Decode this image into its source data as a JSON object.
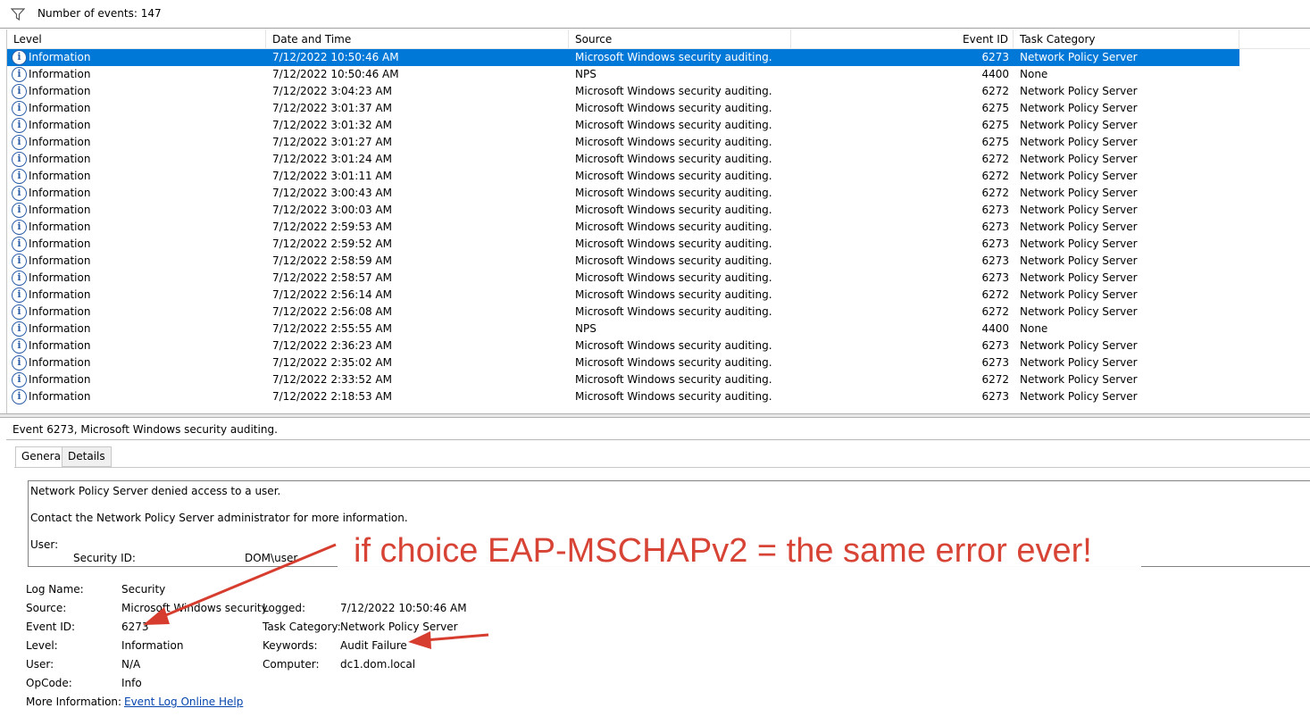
{
  "toolbar": {
    "icon": "filter-icon",
    "event_count_text": "Number of events: 147"
  },
  "grid": {
    "columns": {
      "level": "Level",
      "date": "Date and Time",
      "source": "Source",
      "event_id": "Event ID",
      "task": "Task Category"
    },
    "rows": [
      {
        "level": "Information",
        "date": "7/12/2022 10:50:46 AM",
        "source": "Microsoft Windows security auditing.",
        "event_id": "6273",
        "task": "Network Policy Server",
        "selected": true
      },
      {
        "level": "Information",
        "date": "7/12/2022 10:50:46 AM",
        "source": "NPS",
        "event_id": "4400",
        "task": "None"
      },
      {
        "level": "Information",
        "date": "7/12/2022 3:04:23 AM",
        "source": "Microsoft Windows security auditing.",
        "event_id": "6272",
        "task": "Network Policy Server"
      },
      {
        "level": "Information",
        "date": "7/12/2022 3:01:37 AM",
        "source": "Microsoft Windows security auditing.",
        "event_id": "6275",
        "task": "Network Policy Server"
      },
      {
        "level": "Information",
        "date": "7/12/2022 3:01:32 AM",
        "source": "Microsoft Windows security auditing.",
        "event_id": "6275",
        "task": "Network Policy Server"
      },
      {
        "level": "Information",
        "date": "7/12/2022 3:01:27 AM",
        "source": "Microsoft Windows security auditing.",
        "event_id": "6275",
        "task": "Network Policy Server"
      },
      {
        "level": "Information",
        "date": "7/12/2022 3:01:24 AM",
        "source": "Microsoft Windows security auditing.",
        "event_id": "6272",
        "task": "Network Policy Server"
      },
      {
        "level": "Information",
        "date": "7/12/2022 3:01:11 AM",
        "source": "Microsoft Windows security auditing.",
        "event_id": "6272",
        "task": "Network Policy Server"
      },
      {
        "level": "Information",
        "date": "7/12/2022 3:00:43 AM",
        "source": "Microsoft Windows security auditing.",
        "event_id": "6272",
        "task": "Network Policy Server"
      },
      {
        "level": "Information",
        "date": "7/12/2022 3:00:03 AM",
        "source": "Microsoft Windows security auditing.",
        "event_id": "6273",
        "task": "Network Policy Server"
      },
      {
        "level": "Information",
        "date": "7/12/2022 2:59:53 AM",
        "source": "Microsoft Windows security auditing.",
        "event_id": "6273",
        "task": "Network Policy Server"
      },
      {
        "level": "Information",
        "date": "7/12/2022 2:59:52 AM",
        "source": "Microsoft Windows security auditing.",
        "event_id": "6273",
        "task": "Network Policy Server"
      },
      {
        "level": "Information",
        "date": "7/12/2022 2:58:59 AM",
        "source": "Microsoft Windows security auditing.",
        "event_id": "6273",
        "task": "Network Policy Server"
      },
      {
        "level": "Information",
        "date": "7/12/2022 2:58:57 AM",
        "source": "Microsoft Windows security auditing.",
        "event_id": "6273",
        "task": "Network Policy Server"
      },
      {
        "level": "Information",
        "date": "7/12/2022 2:56:14 AM",
        "source": "Microsoft Windows security auditing.",
        "event_id": "6272",
        "task": "Network Policy Server"
      },
      {
        "level": "Information",
        "date": "7/12/2022 2:56:08 AM",
        "source": "Microsoft Windows security auditing.",
        "event_id": "6272",
        "task": "Network Policy Server"
      },
      {
        "level": "Information",
        "date": "7/12/2022 2:55:55 AM",
        "source": "NPS",
        "event_id": "4400",
        "task": "None"
      },
      {
        "level": "Information",
        "date": "7/12/2022 2:36:23 AM",
        "source": "Microsoft Windows security auditing.",
        "event_id": "6273",
        "task": "Network Policy Server"
      },
      {
        "level": "Information",
        "date": "7/12/2022 2:35:02 AM",
        "source": "Microsoft Windows security auditing.",
        "event_id": "6273",
        "task": "Network Policy Server"
      },
      {
        "level": "Information",
        "date": "7/12/2022 2:33:52 AM",
        "source": "Microsoft Windows security auditing.",
        "event_id": "6272",
        "task": "Network Policy Server"
      },
      {
        "level": "Information",
        "date": "7/12/2022 2:18:53 AM",
        "source": "Microsoft Windows security auditing.",
        "event_id": "6273",
        "task": "Network Policy Server"
      }
    ]
  },
  "detail": {
    "title": "Event 6273, Microsoft Windows security auditing.",
    "tabs": [
      "General",
      "Details"
    ],
    "active_tab": "General",
    "description": {
      "line1": "Network Policy Server denied access to a user.",
      "line2": "Contact the Network Policy Server administrator for more information.",
      "user_label": "User:",
      "security_id_label": "Security ID:",
      "security_id_value": "DOM\\user"
    },
    "properties": {
      "log_name_label": "Log Name:",
      "log_name": "Security",
      "source_label": "Source:",
      "source": "Microsoft Windows security",
      "event_id_label": "Event ID:",
      "event_id": "6273",
      "level_label": "Level:",
      "level": "Information",
      "user_label": "User:",
      "user": "N/A",
      "opcode_label": "OpCode:",
      "opcode": "Info",
      "more_info_label": "More Information:",
      "more_info_link": "Event Log Online Help",
      "logged_label": "Logged:",
      "logged": "7/12/2022 10:50:46 AM",
      "task_category_label": "Task Category:",
      "task_category": "Network Policy Server",
      "keywords_label": "Keywords:",
      "keywords": "Audit Failure",
      "computer_label": "Computer:",
      "computer": "dc1.dom.local"
    }
  },
  "annotation": {
    "text": "if choice EAP-MSCHAPv2 = the same error ever!",
    "color": "#d63d2f"
  },
  "colors": {
    "selection": "#0078d7",
    "link": "#0645ad",
    "info_icon": "#2c5ea8"
  }
}
